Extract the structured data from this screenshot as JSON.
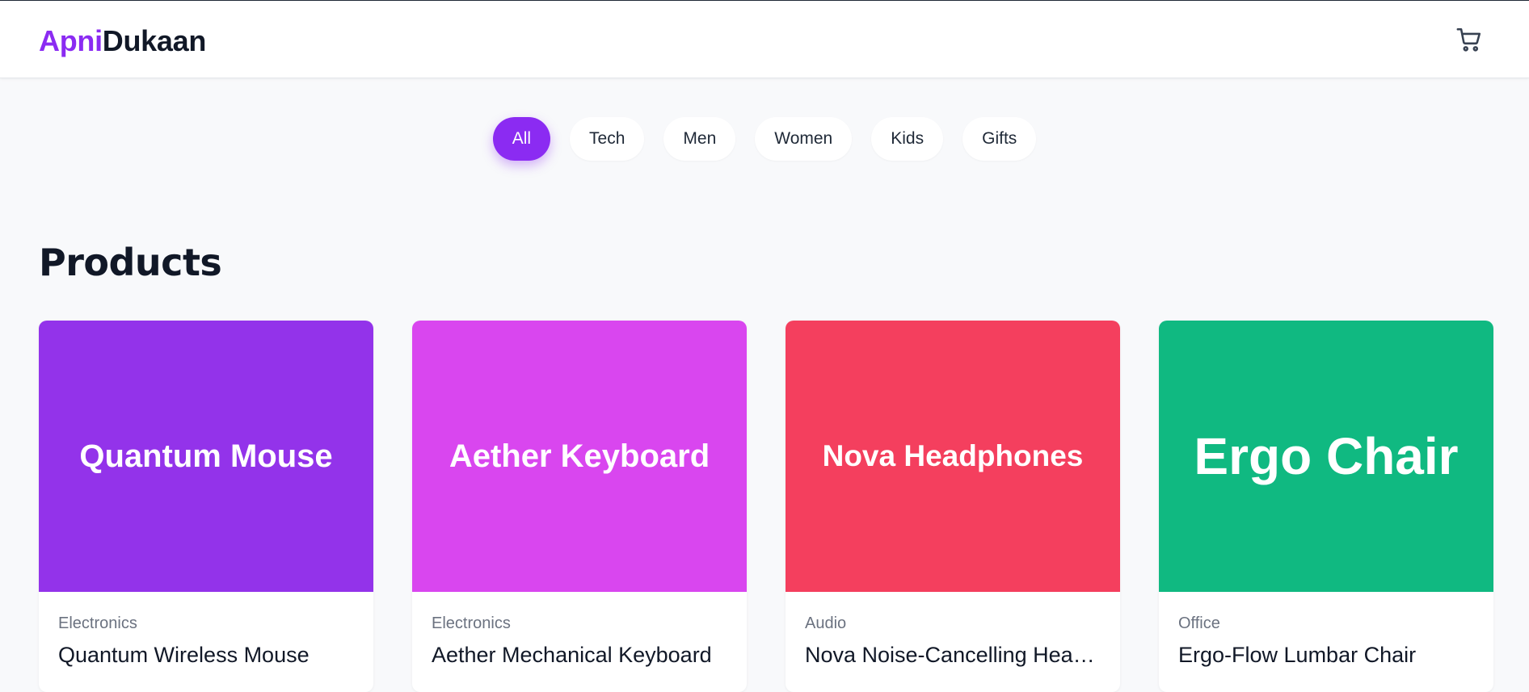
{
  "brand": {
    "part1": "Apni",
    "part2": "Dukaan"
  },
  "header": {
    "cart_icon": "cart-icon"
  },
  "filters": [
    {
      "label": "All",
      "active": true
    },
    {
      "label": "Tech",
      "active": false
    },
    {
      "label": "Men",
      "active": false
    },
    {
      "label": "Women",
      "active": false
    },
    {
      "label": "Kids",
      "active": false
    },
    {
      "label": "Gifts",
      "active": false
    }
  ],
  "section": {
    "title": "Products"
  },
  "products": [
    {
      "image_label": "Quantum Mouse",
      "category": "Electronics",
      "name": "Quantum Wireless Mouse",
      "color": "#9333ea"
    },
    {
      "image_label": "Aether Keyboard",
      "category": "Electronics",
      "name": "Aether Mechanical Keyboard",
      "color": "#d946ef"
    },
    {
      "image_label": "Nova Headphones",
      "category": "Audio",
      "name": "Nova Noise-Cancelling Headphones",
      "color": "#f43f5e"
    },
    {
      "image_label": "Ergo Chair",
      "category": "Office",
      "name": "Ergo-Flow Lumbar Chair",
      "color": "#10b981"
    }
  ],
  "colors": {
    "accent": "#8b2bf2",
    "text": "#111827",
    "muted": "#6b7280",
    "background": "#f8f9fb"
  }
}
